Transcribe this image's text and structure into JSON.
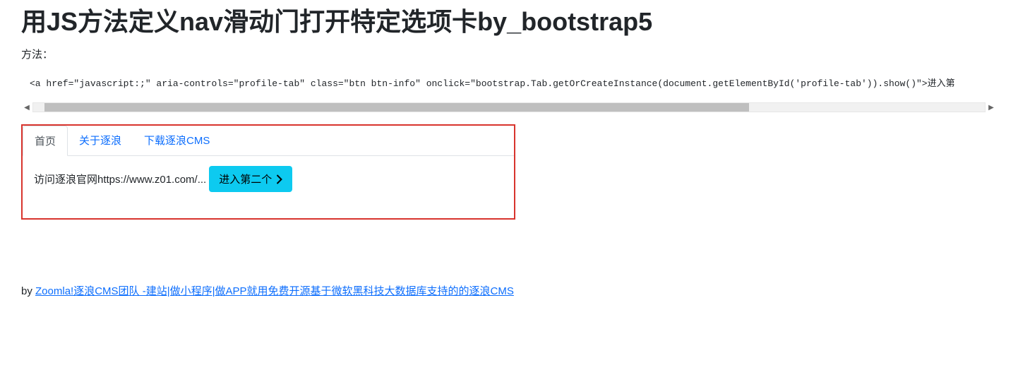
{
  "title": "用JS方法定义nav滑动门打开特定选项卡by_bootstrap5",
  "method_label": "方法：",
  "code_line": "<a href=\"javascript:;\" aria-controls=\"profile-tab\" class=\"btn btn-info\" onclick=\"bootstrap.Tab.getOrCreateInstance(document.getElementById('profile-tab')).show()\">进入第",
  "tabs": {
    "items": [
      {
        "label": "首页",
        "active": true
      },
      {
        "label": "关于逐浪",
        "active": false
      },
      {
        "label": "下载逐浪CMS",
        "active": false
      }
    ]
  },
  "tab_content_text": "访问逐浪官网https://www.z01.com/...",
  "button_label": "进入第二个",
  "footer_prefix": "by ",
  "footer_link_text": "Zoomla!逐浪CMS团队 -建站|做小程序|做APP就用免费开源基于微软黑科技大数据库支持的的逐浪CMS"
}
